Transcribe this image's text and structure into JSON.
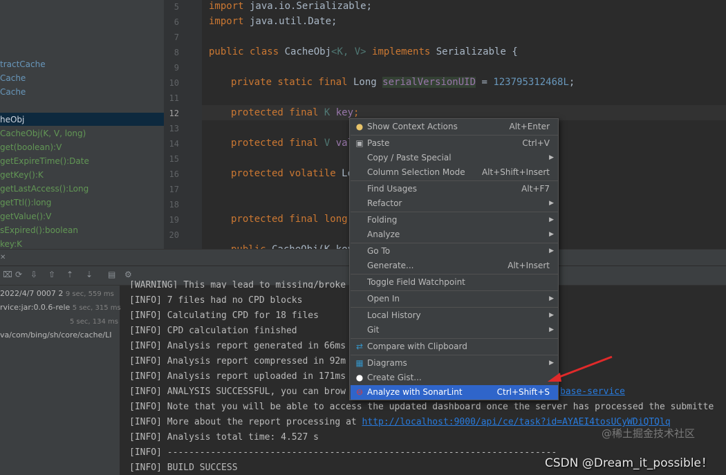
{
  "structure": {
    "items": [
      {
        "text": "tractCache",
        "color": "#6897bb"
      },
      {
        "text": "Cache",
        "color": "#6897bb"
      },
      {
        "text": "Cache",
        "color": "#6897bb"
      },
      {
        "text": "heObj",
        "color": "#cfd6e0"
      },
      {
        "text": "CacheObj(K, V, long)",
        "color": "#629755"
      },
      {
        "text": "get(boolean):V",
        "color": "#629755"
      },
      {
        "text": "getExpireTime():Date",
        "color": "#629755"
      },
      {
        "text": "getKey():K",
        "color": "#629755"
      },
      {
        "text": "getLastAccess():Long",
        "color": "#629755"
      },
      {
        "text": "getTtl():long",
        "color": "#629755"
      },
      {
        "text": "getValue():V",
        "color": "#629755"
      },
      {
        "text": "sExpired():boolean",
        "color": "#629755"
      },
      {
        "text": "key:K",
        "color": "#629755"
      }
    ]
  },
  "editor": {
    "line_numbers": [
      "5",
      "6",
      "7",
      "8",
      "9",
      "10",
      "11",
      "12",
      "13",
      "14",
      "15",
      "16",
      "17",
      "18",
      "19",
      "20"
    ],
    "lines": {
      "l5": {
        "kw": "import",
        "rest": " java.io.Serializable;"
      },
      "l6": {
        "kw": "import",
        "rest": " java.util.Date;"
      },
      "l8": {
        "kw1": "public class",
        "name": " CacheObj",
        "gen": "<K, V>",
        "kw2": " implements",
        "rest": " Serializable {"
      },
      "l10": {
        "kw": "private static final",
        "type": " Long ",
        "field": "serialVersionUID",
        "eq": " = ",
        "num": "123795312468L",
        "end": ";"
      },
      "l12": {
        "kw": "protected final",
        "type": " K ",
        "field": "key",
        "end": ";"
      },
      "l14": {
        "kw": "protected final",
        "type": " V ",
        "field": "valu"
      },
      "l16": {
        "kw": "protected volatile",
        "type": " Lon"
      },
      "l18": {
        "kw": "protected final long",
        "type": " t"
      },
      "l20": {
        "kw": "public",
        "type": " CacheObj(K key"
      }
    }
  },
  "run_panel": {
    "entries": [
      {
        "text": "2022/4/7 0007 2",
        "time": "9 sec, 559 ms"
      },
      {
        "text": "rvice:jar:0.0.6-rele",
        "time": "5 sec, 315 ms"
      },
      {
        "text": "",
        "time": "5 sec, 134 ms"
      },
      {
        "text": "va/com/bing/sh/core/cache/LI",
        "time": ""
      }
    ]
  },
  "console": {
    "lines": [
      "[WARNING] This may lead to missing/broke",
      "[INFO] 7 files had no CPD blocks",
      "[INFO] Calculating CPD for 18 files",
      "[INFO] CPD calculation finished",
      "[INFO] Analysis report generated in 66ms",
      "[INFO] Analysis report compressed in 92m",
      "[INFO] Analysis report uploaded in 171ms",
      "[INFO] ANALYSIS SUCCESSFUL, you can brow",
      "[INFO] Note that you will be able to access the updated dashboard once the server has processed the submitte",
      "[INFO] More about the report processing at ",
      "[INFO] Analysis total time: 4.527 s",
      "[INFO] ------------------------------------------------------------------------",
      "[INFO] BUILD SUCCESS"
    ],
    "link_browse": "base-service",
    "link_task": "http://localhost:9000/api/ce/task?id=AYAEI4tosUCyWDiQTQlq"
  },
  "context_menu": {
    "items": [
      {
        "label": "Show Context Actions",
        "shortcut": "Alt+Enter",
        "icon": "bulb-icon"
      },
      {
        "label": "Paste",
        "shortcut": "Ctrl+V",
        "icon": "clipboard-icon"
      },
      {
        "label": "Copy / Paste Special",
        "shortcut": ""
      },
      {
        "label": "Column Selection Mode",
        "shortcut": "Alt+Shift+Insert"
      },
      {
        "label": "Find Usages",
        "shortcut": "Alt+F7"
      },
      {
        "label": "Refactor",
        "shortcut": ""
      },
      {
        "label": "Folding",
        "shortcut": ""
      },
      {
        "label": "Analyze",
        "shortcut": ""
      },
      {
        "label": "Go To",
        "shortcut": ""
      },
      {
        "label": "Generate...",
        "shortcut": "Alt+Insert"
      },
      {
        "label": "Toggle Field Watchpoint",
        "shortcut": ""
      },
      {
        "label": "Open In",
        "shortcut": ""
      },
      {
        "label": "Local History",
        "shortcut": ""
      },
      {
        "label": "Git",
        "shortcut": ""
      },
      {
        "label": "Compare with Clipboard",
        "shortcut": "",
        "icon": "compare-icon"
      },
      {
        "label": "Diagrams",
        "shortcut": "",
        "icon": "diagram-icon"
      },
      {
        "label": "Create Gist...",
        "shortcut": "",
        "icon": "github-icon"
      },
      {
        "label": "Analyze with SonarLint",
        "shortcut": "Ctrl+Shift+S",
        "icon": "sonarlint-icon"
      }
    ],
    "selected_color": "#2f65ca"
  },
  "watermarks": {
    "juejin": "@稀土掘金技术社区",
    "csdn": "CSDN @Dream_it_possible！"
  }
}
